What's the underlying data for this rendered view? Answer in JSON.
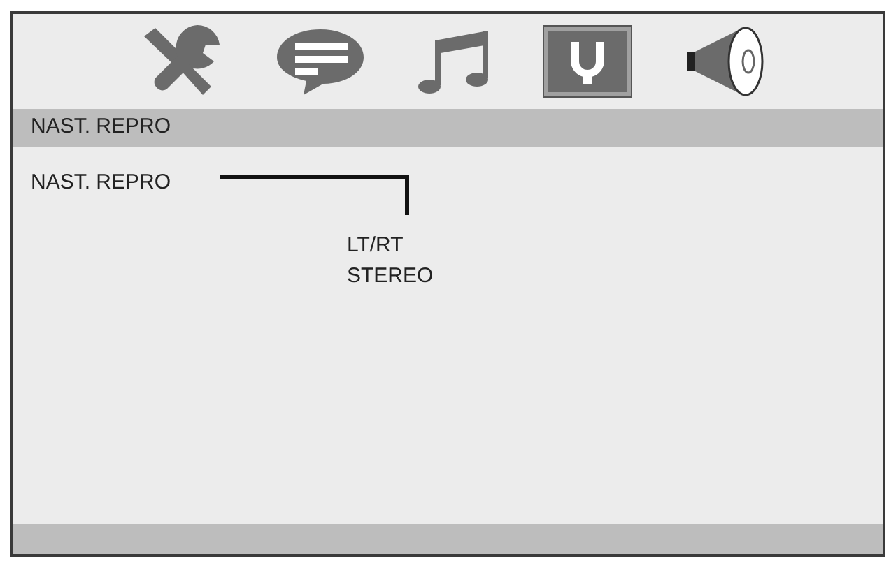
{
  "tabs": [
    {
      "kind": "tools",
      "selected": false
    },
    {
      "kind": "subtitle",
      "selected": false
    },
    {
      "kind": "music",
      "selected": false
    },
    {
      "kind": "speaker-setup",
      "selected": true
    },
    {
      "kind": "speaker",
      "selected": false
    }
  ],
  "header": {
    "title": "NAST. REPRO"
  },
  "item": {
    "label": "NAST. REPRO",
    "options": [
      "LT/RT",
      "STEREO"
    ]
  }
}
